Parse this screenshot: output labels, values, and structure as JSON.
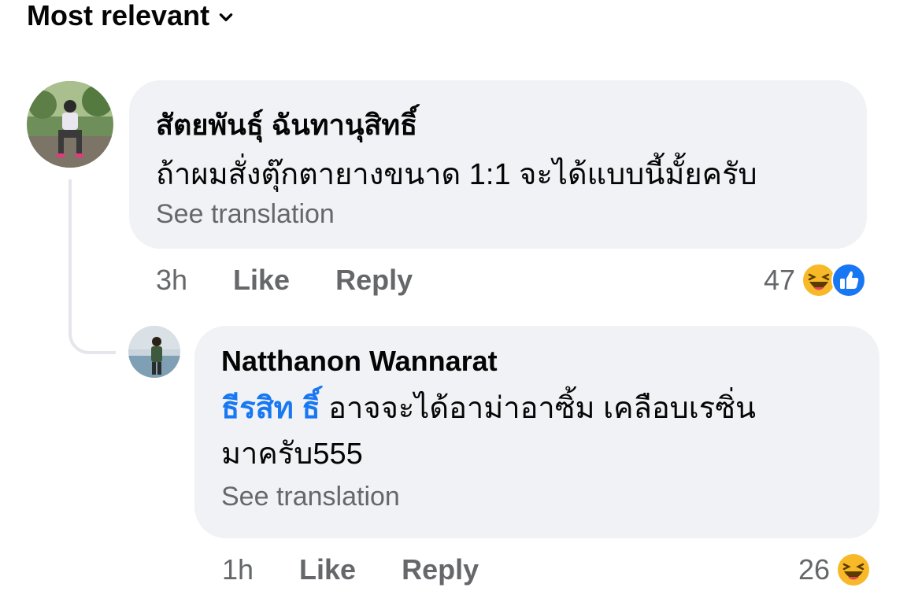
{
  "sort": {
    "label": "Most relevant"
  },
  "comments": [
    {
      "author": "สัตยพันธุ์ ฉันทานุสิทธิ์",
      "text": "ถ้าผมสั่งตุ๊กตายางขนาด 1:1 จะได้แบบนี้มั้ยครับ",
      "see_translation": "See translation",
      "time": "3h",
      "like": "Like",
      "reply": "Reply",
      "reaction_count": "47",
      "reactions": [
        "haha-emoji-icon",
        "like-reaction-icon"
      ]
    },
    {
      "author": "Natthanon Wannarat",
      "mention": "ธีรสิท ธิ์",
      "text_line1": "อาจจะได้อาม่าอาซิ้ม เคลือบเรซิ่น",
      "text_line2": "มาครับ555",
      "see_translation": "See translation",
      "time": "1h",
      "like": "Like",
      "reply": "Reply",
      "reaction_count": "26",
      "reactions": [
        "haha-emoji-icon"
      ]
    }
  ],
  "colors": {
    "bubble": "#f0f2f5",
    "secondary_text": "#65676b",
    "mention": "#1877f2",
    "like_blue": "#1877f2",
    "haha_yellow": "#f7b928"
  }
}
